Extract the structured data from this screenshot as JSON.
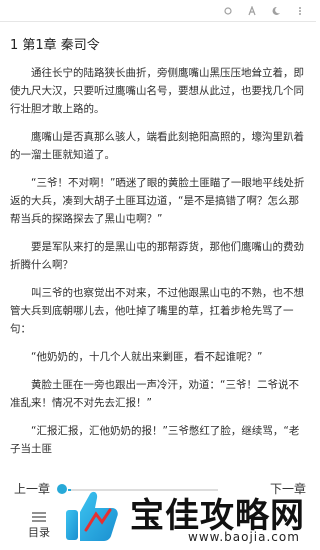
{
  "chapter": {
    "title": "1 第1章 秦司令"
  },
  "paragraphs": [
    "通往长宁的陆路狭长曲折，旁侧鹰嘴山黑压压地耸立着，即使九尺大汉，只要听过鹰嘴山名号，要想从此过，也要找几个同行壮胆才敢上路的。",
    "鹰嘴山是否真那么骇人，端看此刻艳阳高照的，壕沟里趴着的一溜土匪就知道了。",
    "“三爷！不对啊！”晒迷了眼的黄脸土匪瞄了一眼地平线处折返的大兵，凑到大胡子土匪耳边道，“是不是搞错了啊？怎么那帮当兵的探路探去了黑山屯啊？”",
    "要是军队来打的是黑山屯的那帮孬货，那他们鹰嘴山的费劲折腾什么啊？",
    "叫三爷的也察觉出不对来，不过他跟黑山屯的不熟，也不想管大兵到底朝哪儿去，他吐掉了嘴里的草，扛着步枪先骂了一句：",
    "“他奶奶的，十几个人就出来剿匪，看不起谁呢？”",
    "黄脸土匪在一旁也跟出一声冷汗，劝道：“三爷！二爷说不准乱来！情况不对先去汇报！”",
    "“汇报汇报，汇他奶奶的报！”三爷憋红了脸，继续骂，“老子当土匪"
  ],
  "reader_controls": {
    "prev_chapter_label": "上一章",
    "next_chapter_label": "下一章",
    "toc_label": "目录",
    "progress_fraction": 0.02,
    "accent_color": "#27a9d8"
  },
  "top_icons": [
    "settings-icon",
    "font-icon",
    "day-night-icon",
    "more-icon"
  ],
  "watermark": {
    "title": "宝佳攻略网",
    "url": "www.baojia.com"
  }
}
